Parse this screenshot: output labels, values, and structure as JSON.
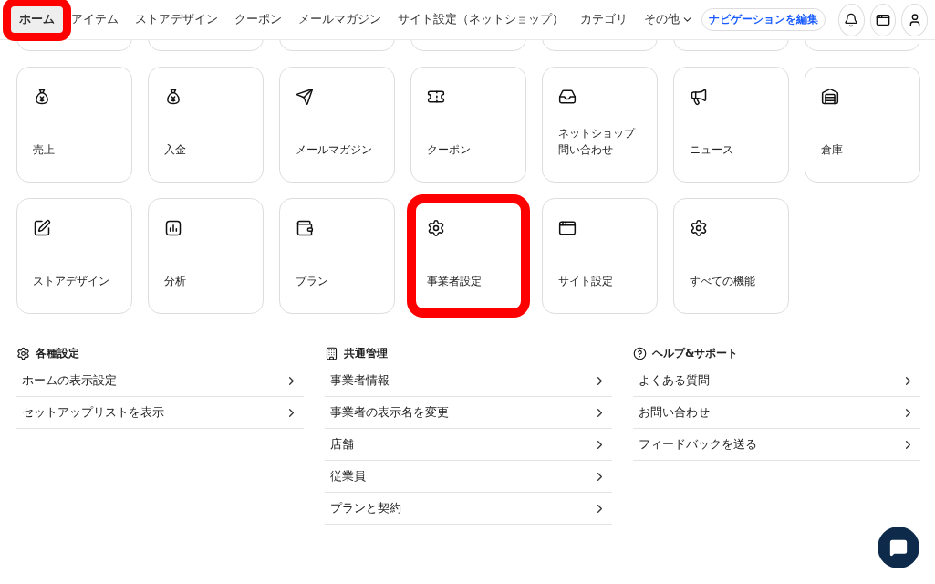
{
  "nav": {
    "tabs": [
      {
        "label": "ホーム",
        "selected": true,
        "highlighted": true
      },
      {
        "label": "アイテム",
        "selected": false,
        "highlighted": false
      },
      {
        "label": "ストアデザイン",
        "selected": false,
        "highlighted": false
      },
      {
        "label": "クーポン",
        "selected": false,
        "highlighted": false
      },
      {
        "label": "メールマガジン",
        "selected": false,
        "highlighted": false
      },
      {
        "label": "サイト設定（ネットショップ）",
        "selected": false,
        "highlighted": false
      },
      {
        "label": "カテゴリ",
        "selected": false,
        "highlighted": false
      }
    ],
    "more": "その他",
    "edit_button": "ナビゲーションを編集"
  },
  "cards": [
    {
      "kind": "moneybag",
      "label": "売上",
      "highlighted": false
    },
    {
      "kind": "moneybag",
      "label": "入金",
      "highlighted": false
    },
    {
      "kind": "send",
      "label": "メールマガジン",
      "highlighted": false
    },
    {
      "kind": "ticket",
      "label": "クーポン",
      "highlighted": false
    },
    {
      "kind": "inbox",
      "caption": "ネットショップ",
      "label": "問い合わせ",
      "highlighted": false
    },
    {
      "kind": "megaphone",
      "label": "ニュース",
      "highlighted": false
    },
    {
      "kind": "warehouse",
      "label": "倉庫",
      "highlighted": false
    },
    {
      "kind": "pen",
      "label": "ストアデザイン",
      "highlighted": false
    },
    {
      "kind": "chart",
      "label": "分析",
      "highlighted": false
    },
    {
      "kind": "wallet",
      "label": "プラン",
      "highlighted": false
    },
    {
      "kind": "gear",
      "label": "事業者設定",
      "highlighted": true
    },
    {
      "kind": "window",
      "label": "サイト設定",
      "highlighted": false
    },
    {
      "kind": "gear",
      "label": "すべての機能",
      "highlighted": false
    }
  ],
  "sections": [
    {
      "kind": "gear",
      "title": "各種設定",
      "items": [
        "ホームの表示設定",
        "セットアップリストを表示"
      ]
    },
    {
      "kind": "building",
      "title": "共通管理",
      "items": [
        "事業者情報",
        "事業者の表示名を変更",
        "店舗",
        "従業員",
        "プランと契約"
      ]
    },
    {
      "kind": "help",
      "title": "ヘルプ&サポート",
      "items": [
        "よくある質問",
        "お問い合わせ",
        "フィードバックを送る"
      ]
    }
  ]
}
